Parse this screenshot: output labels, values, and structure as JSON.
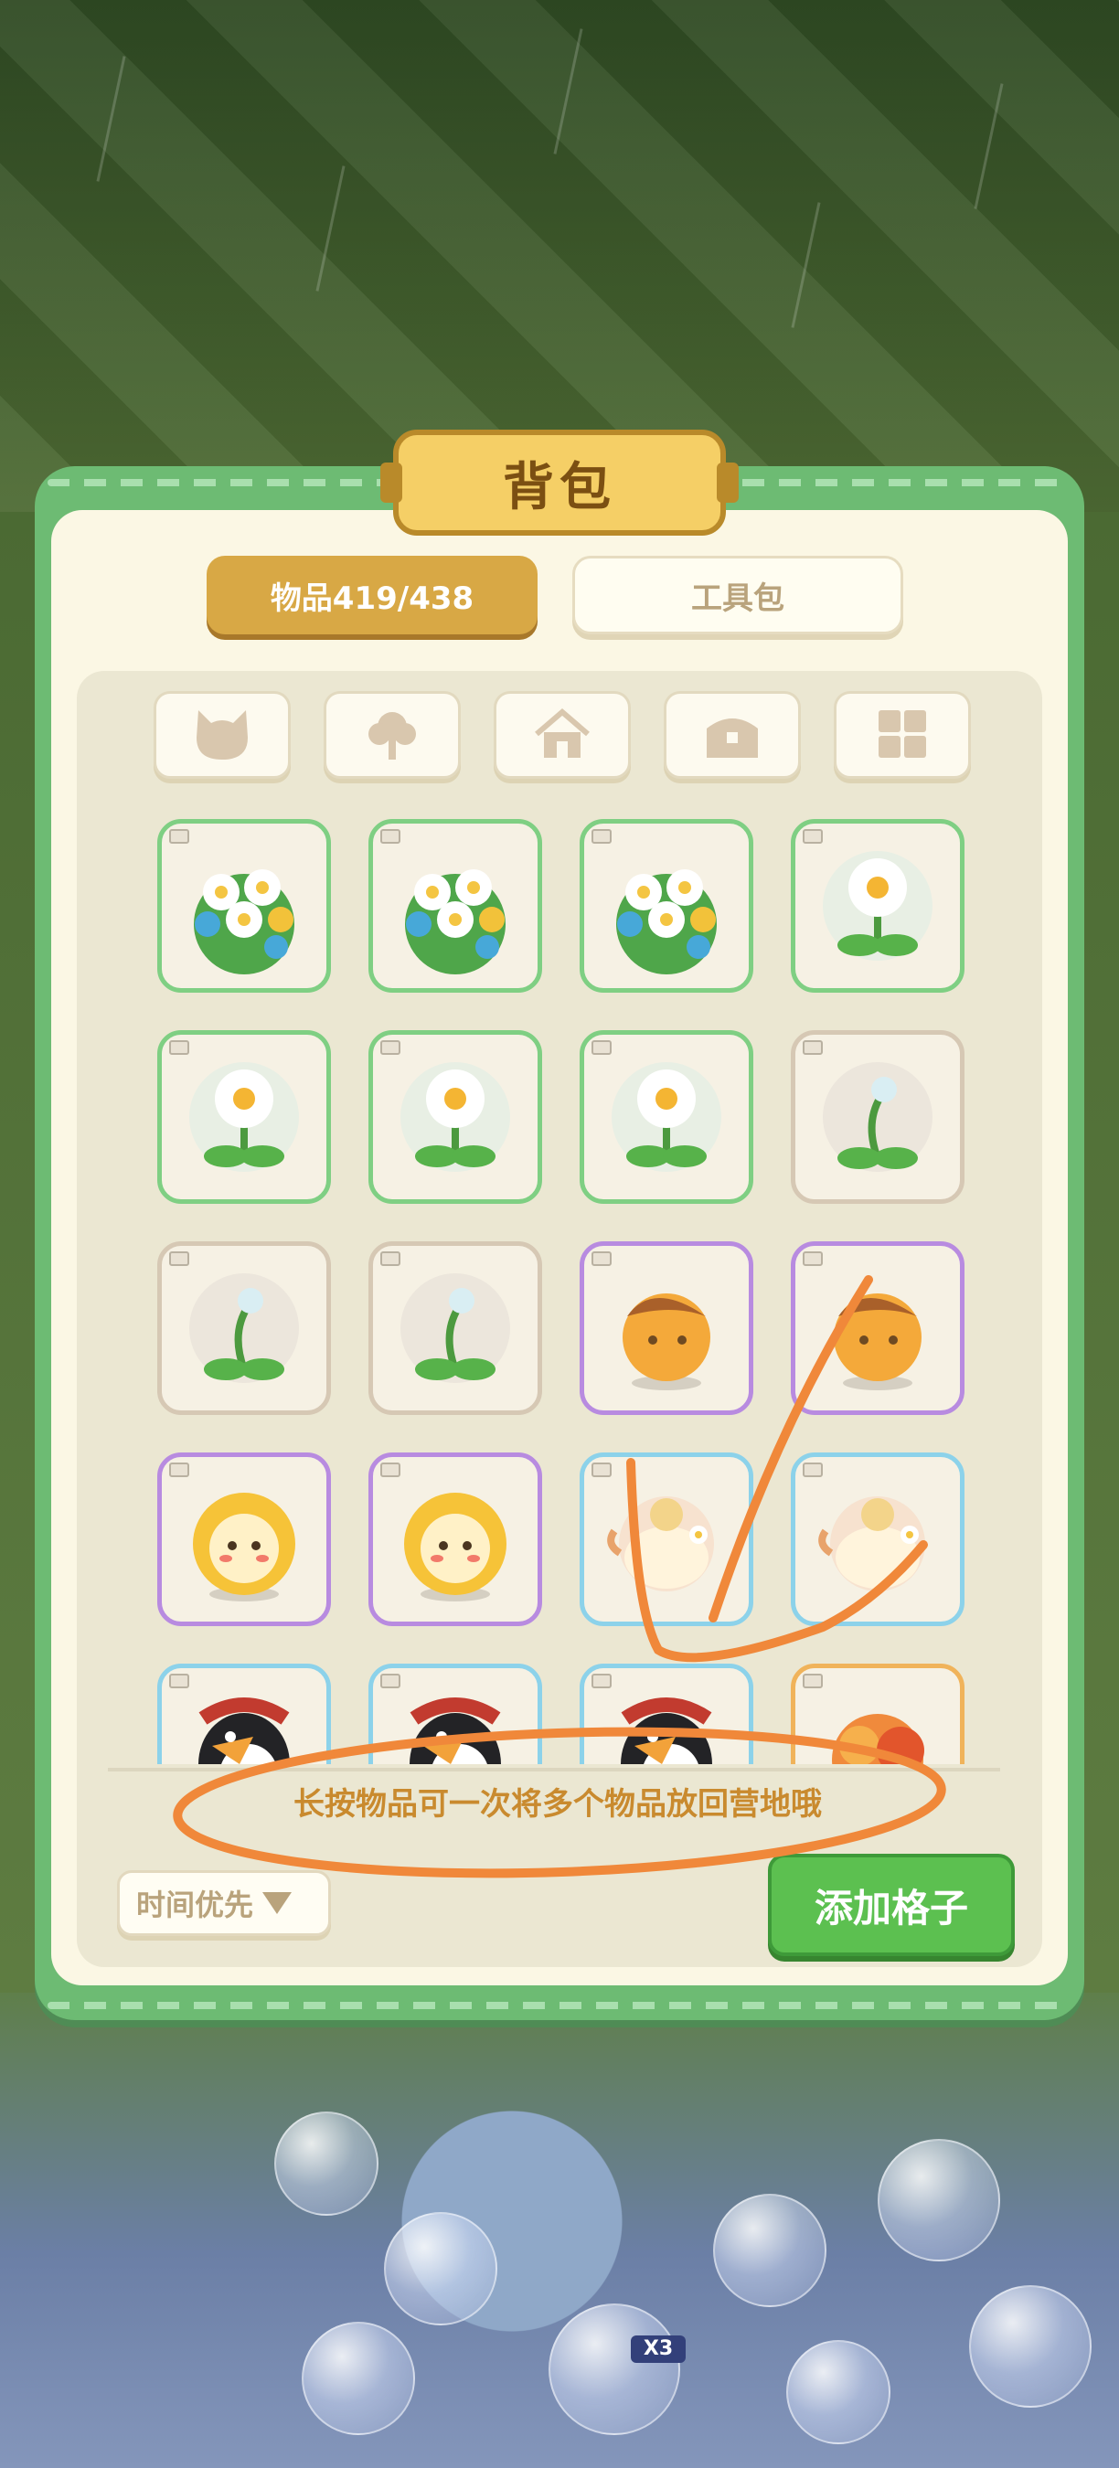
{
  "panel": {
    "title": "背包",
    "tabs": [
      {
        "label": "物品419/438",
        "active": true
      },
      {
        "label": "工具包",
        "active": false
      }
    ],
    "filters": [
      {
        "icon": "cat-icon"
      },
      {
        "icon": "tree-icon"
      },
      {
        "icon": "house-icon"
      },
      {
        "icon": "chest-icon"
      },
      {
        "icon": "grid-icon"
      }
    ],
    "items": [
      {
        "item": "flower-bouquet",
        "rarity": "green"
      },
      {
        "item": "flower-bouquet",
        "rarity": "green"
      },
      {
        "item": "flower-bouquet",
        "rarity": "green"
      },
      {
        "item": "daisy",
        "rarity": "green"
      },
      {
        "item": "daisy",
        "rarity": "green"
      },
      {
        "item": "daisy",
        "rarity": "green"
      },
      {
        "item": "daisy",
        "rarity": "green"
      },
      {
        "item": "sprout-bud",
        "rarity": "brown"
      },
      {
        "item": "sprout-bud",
        "rarity": "brown"
      },
      {
        "item": "sprout-bud",
        "rarity": "brown"
      },
      {
        "item": "fox-ball",
        "rarity": "purple"
      },
      {
        "item": "fox-ball",
        "rarity": "purple"
      },
      {
        "item": "lion-ball",
        "rarity": "purple"
      },
      {
        "item": "lion-ball",
        "rarity": "purple"
      },
      {
        "item": "teapot-fairy",
        "rarity": "blue"
      },
      {
        "item": "teapot-fairy",
        "rarity": "blue"
      },
      {
        "item": "penguin",
        "rarity": "blue"
      },
      {
        "item": "penguin",
        "rarity": "blue"
      },
      {
        "item": "penguin",
        "rarity": "blue"
      },
      {
        "item": "fire-creature",
        "rarity": "orange"
      }
    ],
    "hint": "长按物品可一次将多个物品放回营地哦",
    "sort_label": "时间优先",
    "add_button": "添加格子"
  },
  "background": {
    "bubble_badge": "X3"
  },
  "colors": {
    "panel_green": "#6dbb73",
    "panel_cream": "#fbf7e4",
    "active_tab": "#d8a845",
    "add_button": "#5cc050",
    "hint_text": "#c98a2e",
    "annotation_orange": "#f0883a"
  }
}
